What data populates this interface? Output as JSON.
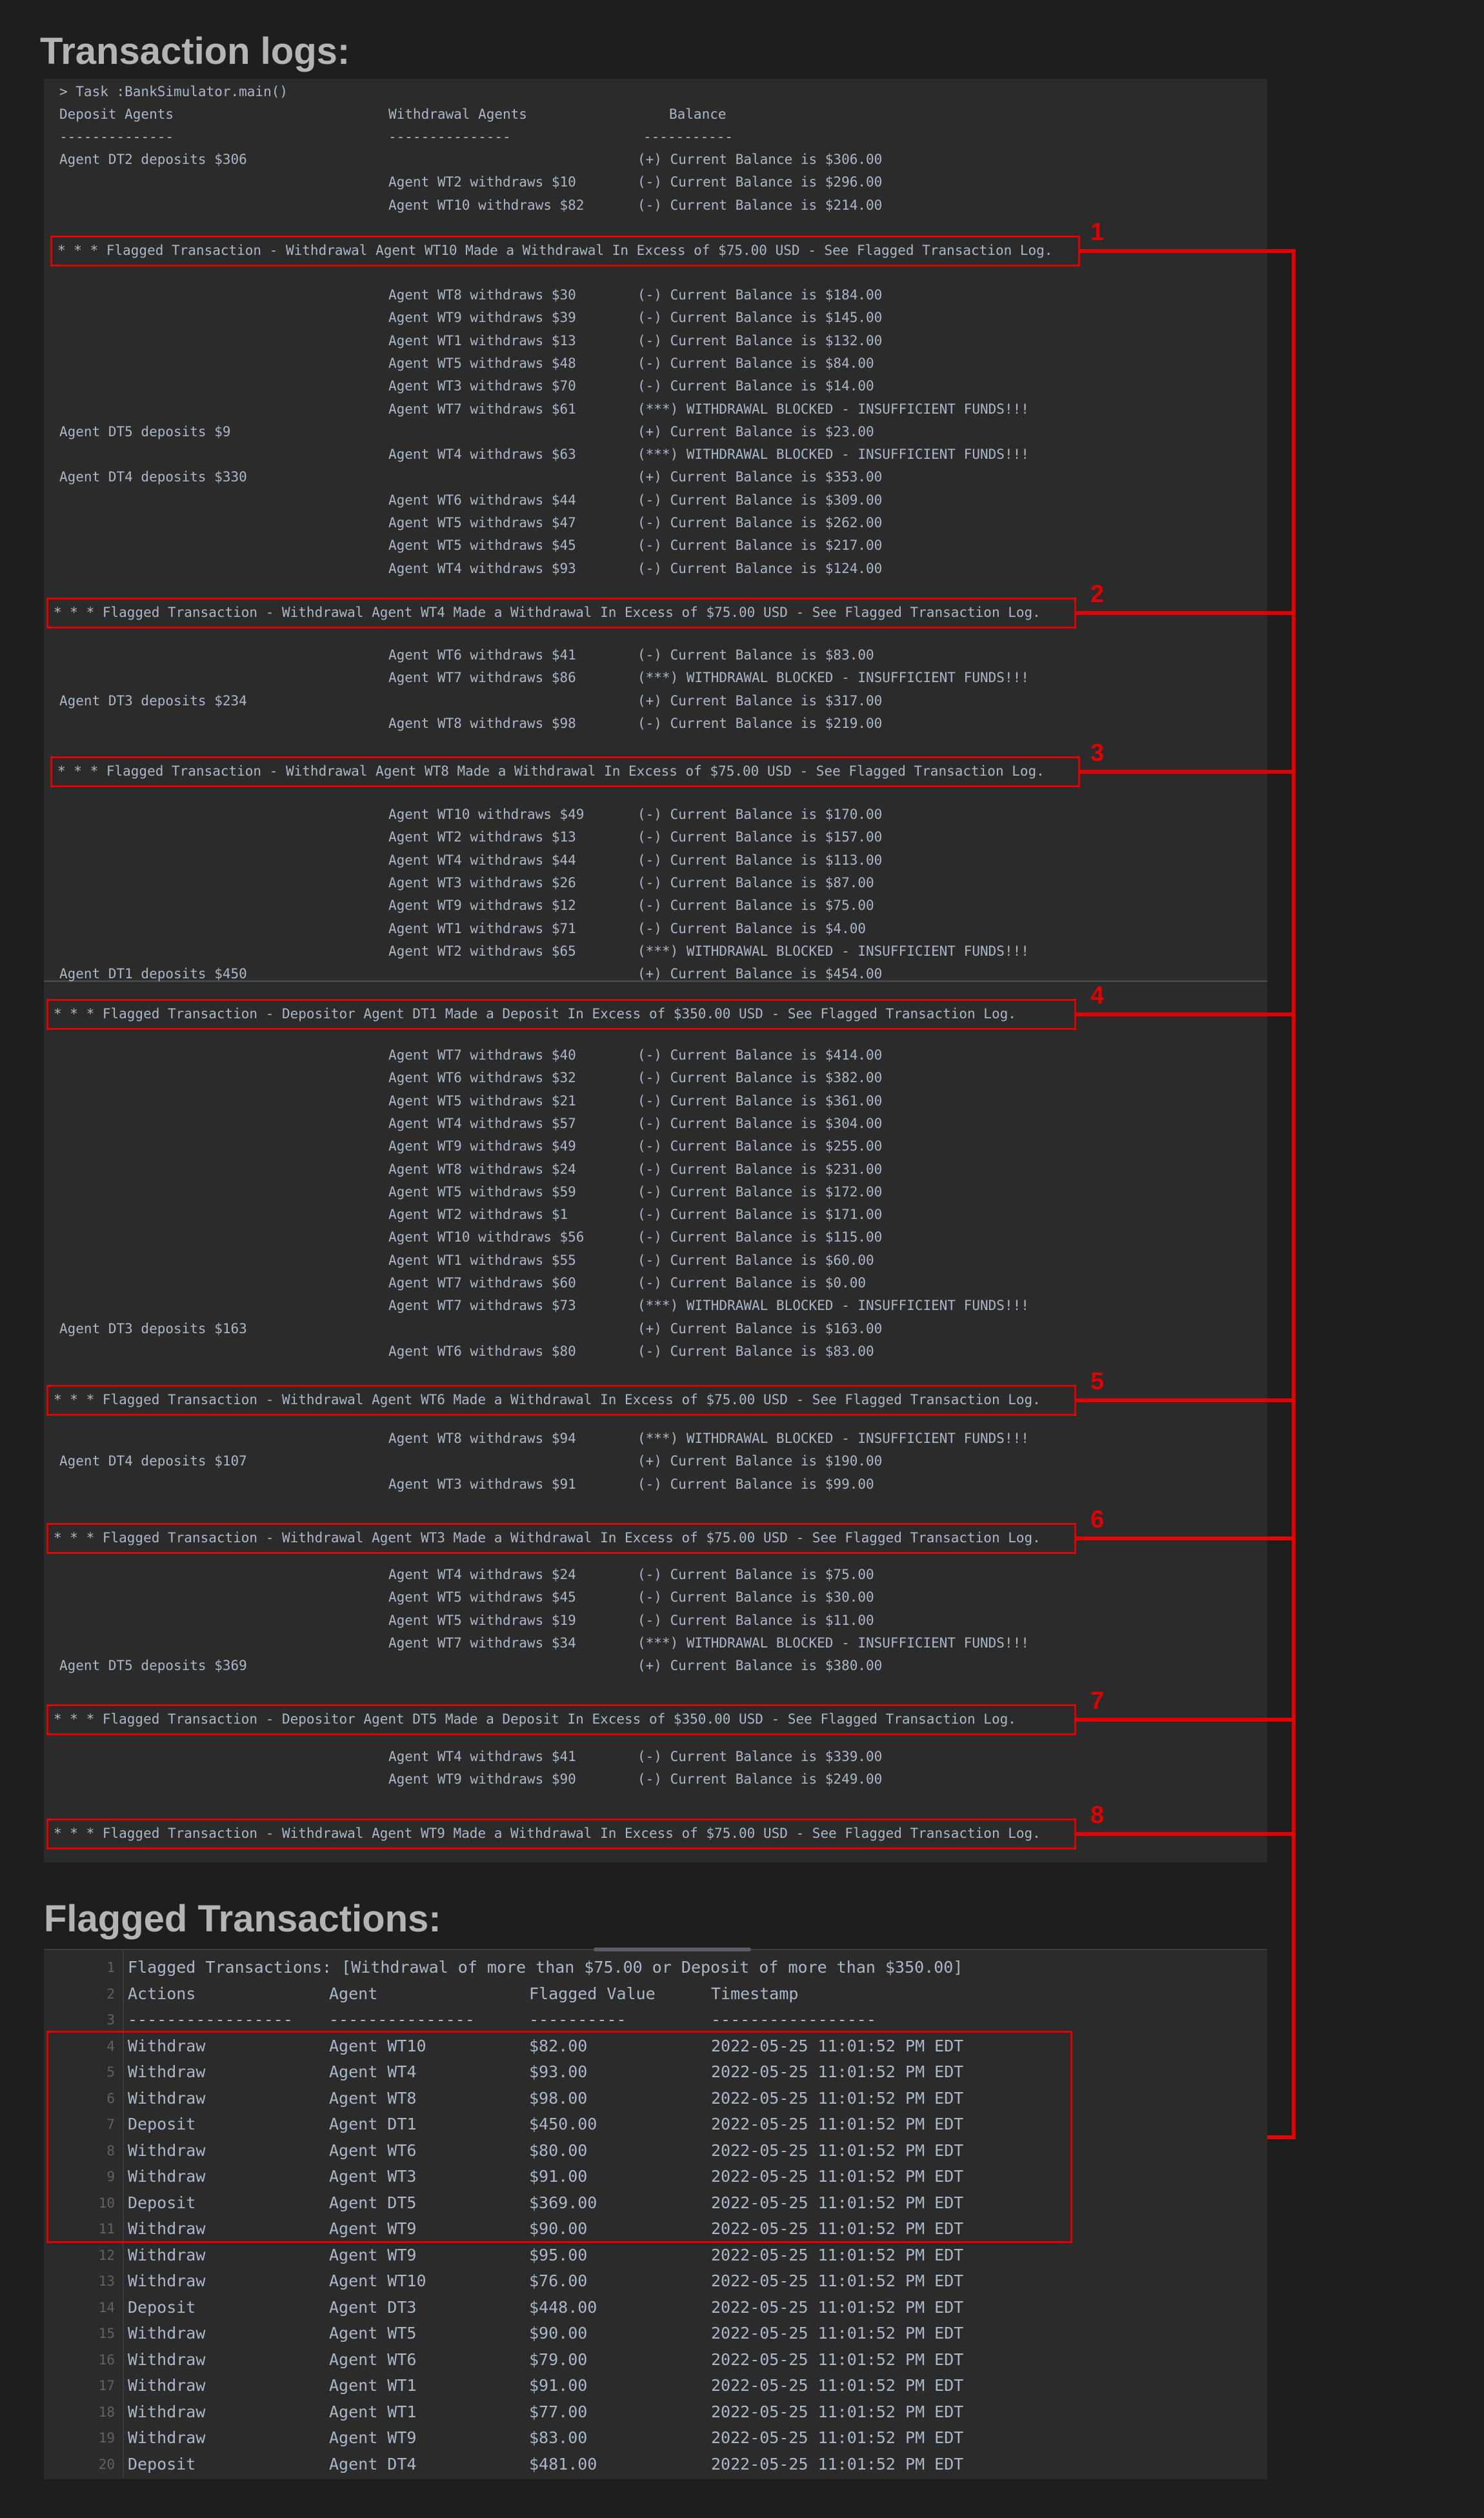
{
  "headings": {
    "logs": "Transaction logs:",
    "flagged": "Flagged Transactions:"
  },
  "console": {
    "task_line": "> Task :BankSimulator.main()",
    "col_headers": {
      "deposit": "Deposit Agents",
      "withdrawal": "Withdrawal Agents",
      "balance": "Balance"
    },
    "dashes": {
      "deposit": "--------------",
      "withdrawal": "---------------",
      "balance": "-----------"
    },
    "lines": [
      {
        "d": "Agent DT2 deposits $306",
        "w": "",
        "b": "(+) Current Balance is $306.00"
      },
      {
        "d": "",
        "w": "Agent WT2 withdraws $10",
        "b": "(-) Current Balance is $296.00"
      },
      {
        "d": "",
        "w": "Agent WT10 withdraws $82",
        "b": "(-) Current Balance is $214.00"
      },
      {
        "d": "",
        "w": "Agent WT8 withdraws $30",
        "b": "(-) Current Balance is $184.00"
      },
      {
        "d": "",
        "w": "Agent WT9 withdraws $39",
        "b": "(-) Current Balance is $145.00"
      },
      {
        "d": "",
        "w": "Agent WT1 withdraws $13",
        "b": "(-) Current Balance is $132.00"
      },
      {
        "d": "",
        "w": "Agent WT5 withdraws $48",
        "b": "(-) Current Balance is $84.00"
      },
      {
        "d": "",
        "w": "Agent WT3 withdraws $70",
        "b": "(-) Current Balance is $14.00"
      },
      {
        "d": "",
        "w": "Agent WT7 withdraws $61",
        "b": "(***) WITHDRAWAL BLOCKED - INSUFFICIENT FUNDS!!!"
      },
      {
        "d": "Agent DT5 deposits $9",
        "w": "",
        "b": "(+) Current Balance is $23.00"
      },
      {
        "d": "",
        "w": "Agent WT4 withdraws $63",
        "b": "(***) WITHDRAWAL BLOCKED - INSUFFICIENT FUNDS!!!"
      },
      {
        "d": "Agent DT4 deposits $330",
        "w": "",
        "b": "(+) Current Balance is $353.00"
      },
      {
        "d": "",
        "w": "Agent WT6 withdraws $44",
        "b": "(-) Current Balance is $309.00"
      },
      {
        "d": "",
        "w": "Agent WT5 withdraws $47",
        "b": "(-) Current Balance is $262.00"
      },
      {
        "d": "",
        "w": "Agent WT5 withdraws $45",
        "b": "(-) Current Balance is $217.00"
      },
      {
        "d": "",
        "w": "Agent WT4 withdraws $93",
        "b": "(-) Current Balance is $124.00"
      },
      {
        "d": "",
        "w": "Agent WT6 withdraws $41",
        "b": "(-) Current Balance is $83.00"
      },
      {
        "d": "",
        "w": "Agent WT7 withdraws $86",
        "b": "(***) WITHDRAWAL BLOCKED - INSUFFICIENT FUNDS!!!"
      },
      {
        "d": "Agent DT3 deposits $234",
        "w": "",
        "b": "(+) Current Balance is $317.00"
      },
      {
        "d": "",
        "w": "Agent WT8 withdraws $98",
        "b": "(-) Current Balance is $219.00"
      },
      {
        "d": "",
        "w": "Agent WT10 withdraws $49",
        "b": "(-) Current Balance is $170.00"
      },
      {
        "d": "",
        "w": "Agent WT2 withdraws $13",
        "b": "(-) Current Balance is $157.00"
      },
      {
        "d": "",
        "w": "Agent WT4 withdraws $44",
        "b": "(-) Current Balance is $113.00"
      },
      {
        "d": "",
        "w": "Agent WT3 withdraws $26",
        "b": "(-) Current Balance is $87.00"
      },
      {
        "d": "",
        "w": "Agent WT9 withdraws $12",
        "b": "(-) Current Balance is $75.00"
      },
      {
        "d": "",
        "w": "Agent WT1 withdraws $71",
        "b": "(-) Current Balance is $4.00"
      },
      {
        "d": "",
        "w": "Agent WT2 withdraws $65",
        "b": "(***) WITHDRAWAL BLOCKED - INSUFFICIENT FUNDS!!!"
      },
      {
        "d": "Agent DT1 deposits $450",
        "w": "",
        "b": "(+) Current Balance is $454.00"
      },
      {
        "d": "",
        "w": "Agent WT7 withdraws $40",
        "b": "(-) Current Balance is $414.00"
      },
      {
        "d": "",
        "w": "Agent WT6 withdraws $32",
        "b": "(-) Current Balance is $382.00"
      },
      {
        "d": "",
        "w": "Agent WT5 withdraws $21",
        "b": "(-) Current Balance is $361.00"
      },
      {
        "d": "",
        "w": "Agent WT4 withdraws $57",
        "b": "(-) Current Balance is $304.00"
      },
      {
        "d": "",
        "w": "Agent WT9 withdraws $49",
        "b": "(-) Current Balance is $255.00"
      },
      {
        "d": "",
        "w": "Agent WT8 withdraws $24",
        "b": "(-) Current Balance is $231.00"
      },
      {
        "d": "",
        "w": "Agent WT5 withdraws $59",
        "b": "(-) Current Balance is $172.00"
      },
      {
        "d": "",
        "w": "Agent WT2 withdraws $1",
        "b": "(-) Current Balance is $171.00"
      },
      {
        "d": "",
        "w": "Agent WT10 withdraws $56",
        "b": "(-) Current Balance is $115.00"
      },
      {
        "d": "",
        "w": "Agent WT1 withdraws $55",
        "b": "(-) Current Balance is $60.00"
      },
      {
        "d": "",
        "w": "Agent WT7 withdraws $60",
        "b": "(-) Current Balance is $0.00"
      },
      {
        "d": "",
        "w": "Agent WT7 withdraws $73",
        "b": "(***) WITHDRAWAL BLOCKED - INSUFFICIENT FUNDS!!!"
      },
      {
        "d": "Agent DT3 deposits $163",
        "w": "",
        "b": "(+) Current Balance is $163.00"
      },
      {
        "d": "",
        "w": "Agent WT6 withdraws $80",
        "b": "(-) Current Balance is $83.00"
      },
      {
        "d": "",
        "w": "Agent WT8 withdraws $94",
        "b": "(***) WITHDRAWAL BLOCKED - INSUFFICIENT FUNDS!!!"
      },
      {
        "d": "Agent DT4 deposits $107",
        "w": "",
        "b": "(+) Current Balance is $190.00"
      },
      {
        "d": "",
        "w": "Agent WT3 withdraws $91",
        "b": "(-) Current Balance is $99.00"
      },
      {
        "d": "",
        "w": "Agent WT4 withdraws $24",
        "b": "(-) Current Balance is $75.00"
      },
      {
        "d": "",
        "w": "Agent WT5 withdraws $45",
        "b": "(-) Current Balance is $30.00"
      },
      {
        "d": "",
        "w": "Agent WT5 withdraws $19",
        "b": "(-) Current Balance is $11.00"
      },
      {
        "d": "",
        "w": "Agent WT7 withdraws $34",
        "b": "(***) WITHDRAWAL BLOCKED - INSUFFICIENT FUNDS!!!"
      },
      {
        "d": "Agent DT5 deposits $369",
        "w": "",
        "b": "(+) Current Balance is $380.00"
      },
      {
        "d": "",
        "w": "Agent WT4 withdraws $41",
        "b": "(-) Current Balance is $339.00"
      },
      {
        "d": "",
        "w": "Agent WT9 withdraws $90",
        "b": "(-) Current Balance is $249.00"
      }
    ],
    "flags": [
      {
        "num": "1",
        "text": "* * * Flagged Transaction - Withdrawal Agent WT10 Made a Withdrawal In Excess of $75.00 USD - See Flagged Transaction Log."
      },
      {
        "num": "2",
        "text": "* * * Flagged Transaction - Withdrawal Agent WT4 Made a Withdrawal In Excess of $75.00 USD - See Flagged Transaction Log."
      },
      {
        "num": "3",
        "text": "* * * Flagged Transaction - Withdrawal Agent WT8 Made a Withdrawal In Excess of $75.00 USD - See Flagged Transaction Log."
      },
      {
        "num": "4",
        "text": "* * * Flagged Transaction - Depositor Agent DT1 Made a Deposit In Excess of $350.00 USD - See Flagged Transaction Log."
      },
      {
        "num": "5",
        "text": "* * * Flagged Transaction - Withdrawal Agent WT6 Made a Withdrawal In Excess of $75.00 USD - See Flagged Transaction Log."
      },
      {
        "num": "6",
        "text": "* * * Flagged Transaction - Withdrawal Agent WT3 Made a Withdrawal In Excess of $75.00 USD - See Flagged Transaction Log."
      },
      {
        "num": "7",
        "text": "* * * Flagged Transaction - Depositor Agent DT5 Made a Deposit In Excess of $350.00 USD - See Flagged Transaction Log."
      },
      {
        "num": "8",
        "text": "* * * Flagged Transaction - Withdrawal Agent WT9 Made a Withdrawal In Excess of $75.00 USD - See Flagged Transaction Log."
      }
    ]
  },
  "flagged_log": {
    "title_line": "Flagged Transactions: [Withdrawal of more than $75.00 or Deposit of more than $350.00]",
    "headers": [
      "Actions",
      "Agent",
      "Flagged Value",
      "Timestamp"
    ],
    "dashes": [
      "-----------------",
      "---------------",
      "----------",
      "-----------------"
    ],
    "line_numbers": [
      "1",
      "2",
      "3",
      "4",
      "5",
      "6",
      "7",
      "8",
      "9",
      "10",
      "11",
      "12",
      "13",
      "14",
      "15",
      "16",
      "17",
      "18",
      "19",
      "20"
    ],
    "rows": [
      [
        "Withdraw",
        "Agent WT10",
        "$82.00",
        "2022-05-25 11:01:52 PM EDT"
      ],
      [
        "Withdraw",
        "Agent WT4",
        "$93.00",
        "2022-05-25 11:01:52 PM EDT"
      ],
      [
        "Withdraw",
        "Agent WT8",
        "$98.00",
        "2022-05-25 11:01:52 PM EDT"
      ],
      [
        "Deposit",
        "Agent DT1",
        "$450.00",
        "2022-05-25 11:01:52 PM EDT"
      ],
      [
        "Withdraw",
        "Agent WT6",
        "$80.00",
        "2022-05-25 11:01:52 PM EDT"
      ],
      [
        "Withdraw",
        "Agent WT3",
        "$91.00",
        "2022-05-25 11:01:52 PM EDT"
      ],
      [
        "Deposit",
        "Agent DT5",
        "$369.00",
        "2022-05-25 11:01:52 PM EDT"
      ],
      [
        "Withdraw",
        "Agent WT9",
        "$90.00",
        "2022-05-25 11:01:52 PM EDT"
      ],
      [
        "Withdraw",
        "Agent WT9",
        "$95.00",
        "2022-05-25 11:01:52 PM EDT"
      ],
      [
        "Withdraw",
        "Agent WT10",
        "$76.00",
        "2022-05-25 11:01:52 PM EDT"
      ],
      [
        "Deposit",
        "Agent DT3",
        "$448.00",
        "2022-05-25 11:01:52 PM EDT"
      ],
      [
        "Withdraw",
        "Agent WT5",
        "$90.00",
        "2022-05-25 11:01:52 PM EDT"
      ],
      [
        "Withdraw",
        "Agent WT6",
        "$79.00",
        "2022-05-25 11:01:52 PM EDT"
      ],
      [
        "Withdraw",
        "Agent WT1",
        "$91.00",
        "2022-05-25 11:01:52 PM EDT"
      ],
      [
        "Withdraw",
        "Agent WT1",
        "$77.00",
        "2022-05-25 11:01:52 PM EDT"
      ],
      [
        "Withdraw",
        "Agent WT9",
        "$83.00",
        "2022-05-25 11:01:52 PM EDT"
      ],
      [
        "Deposit",
        "Agent DT4",
        "$481.00",
        "2022-05-25 11:01:52 PM EDT"
      ]
    ]
  },
  "colors": {
    "annotation": "#e00000",
    "console_bg": "#2b2b2b",
    "page_bg": "#1e1e1e",
    "text": "#a9b7c6"
  }
}
